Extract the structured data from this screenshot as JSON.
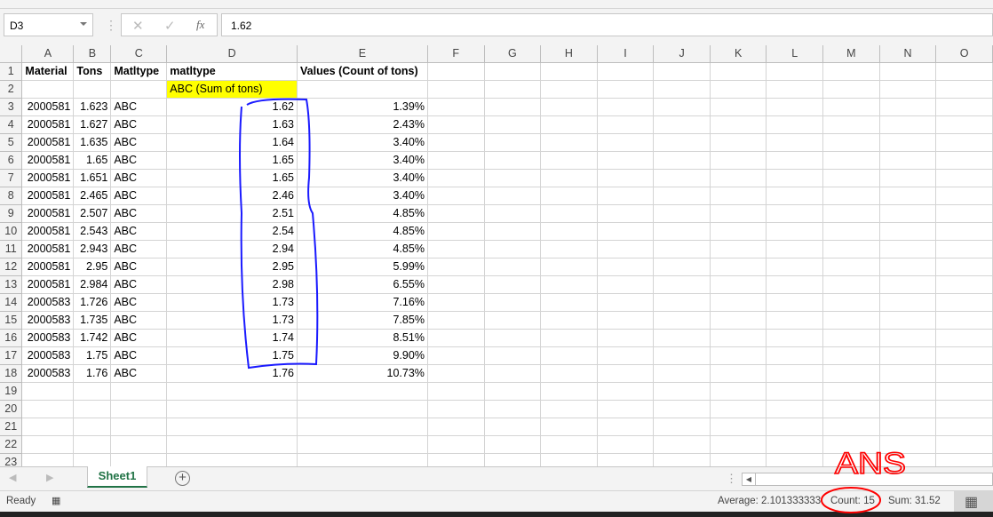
{
  "formula_bar": {
    "name_box": "D3",
    "formula": "1.62",
    "cancel_icon": "✕",
    "enter_icon": "✓",
    "fx_label": "fx"
  },
  "columns": [
    "A",
    "B",
    "C",
    "D",
    "E",
    "F",
    "G",
    "H",
    "I",
    "J",
    "K",
    "L",
    "M",
    "N",
    "O"
  ],
  "rows": [
    {
      "n": "1",
      "cells": [
        "Material",
        "Tons",
        "Matltype",
        "matltype",
        "Values (Count of tons)"
      ]
    },
    {
      "n": "2",
      "cells": [
        "",
        "",
        "",
        "ABC (Sum of tons)",
        ""
      ]
    },
    {
      "n": "3",
      "cells": [
        "2000581",
        "1.623",
        "ABC",
        "1.62",
        "1.39%"
      ]
    },
    {
      "n": "4",
      "cells": [
        "2000581",
        "1.627",
        "ABC",
        "1.63",
        "2.43%"
      ]
    },
    {
      "n": "5",
      "cells": [
        "2000581",
        "1.635",
        "ABC",
        "1.64",
        "3.40%"
      ]
    },
    {
      "n": "6",
      "cells": [
        "2000581",
        "1.65",
        "ABC",
        "1.65",
        "3.40%"
      ]
    },
    {
      "n": "7",
      "cells": [
        "2000581",
        "1.651",
        "ABC",
        "1.65",
        "3.40%"
      ]
    },
    {
      "n": "8",
      "cells": [
        "2000581",
        "2.465",
        "ABC",
        "2.46",
        "3.40%"
      ]
    },
    {
      "n": "9",
      "cells": [
        "2000581",
        "2.507",
        "ABC",
        "2.51",
        "4.85%"
      ]
    },
    {
      "n": "10",
      "cells": [
        "2000581",
        "2.543",
        "ABC",
        "2.54",
        "4.85%"
      ]
    },
    {
      "n": "11",
      "cells": [
        "2000581",
        "2.943",
        "ABC",
        "2.94",
        "4.85%"
      ]
    },
    {
      "n": "12",
      "cells": [
        "2000581",
        "2.95",
        "ABC",
        "2.95",
        "5.99%"
      ]
    },
    {
      "n": "13",
      "cells": [
        "2000581",
        "2.984",
        "ABC",
        "2.98",
        "6.55%"
      ]
    },
    {
      "n": "14",
      "cells": [
        "2000583",
        "1.726",
        "ABC",
        "1.73",
        "7.16%"
      ]
    },
    {
      "n": "15",
      "cells": [
        "2000583",
        "1.735",
        "ABC",
        "1.73",
        "7.85%"
      ]
    },
    {
      "n": "16",
      "cells": [
        "2000583",
        "1.742",
        "ABC",
        "1.74",
        "8.51%"
      ]
    },
    {
      "n": "17",
      "cells": [
        "2000583",
        "1.75",
        "ABC",
        "1.75",
        "9.90%"
      ]
    },
    {
      "n": "18",
      "cells": [
        "2000583",
        "1.76",
        "ABC",
        "1.76",
        "10.73%"
      ]
    },
    {
      "n": "19",
      "cells": []
    },
    {
      "n": "20",
      "cells": []
    },
    {
      "n": "21",
      "cells": []
    },
    {
      "n": "22",
      "cells": []
    },
    {
      "n": "23",
      "cells": []
    }
  ],
  "highlight_color": "#ffff00",
  "sheet_tabs": [
    {
      "label": "Sheet1",
      "active": true
    }
  ],
  "add_sheet_icon": "+",
  "status": {
    "ready": "Ready",
    "average": "Average: 2.101333333",
    "count": "Count: 15",
    "sum": "Sum: 31.52"
  },
  "annotations": {
    "handwritten_text": "ANS",
    "pen_colors": {
      "blue": "#1a1aff",
      "red": "#ff0000"
    }
  }
}
